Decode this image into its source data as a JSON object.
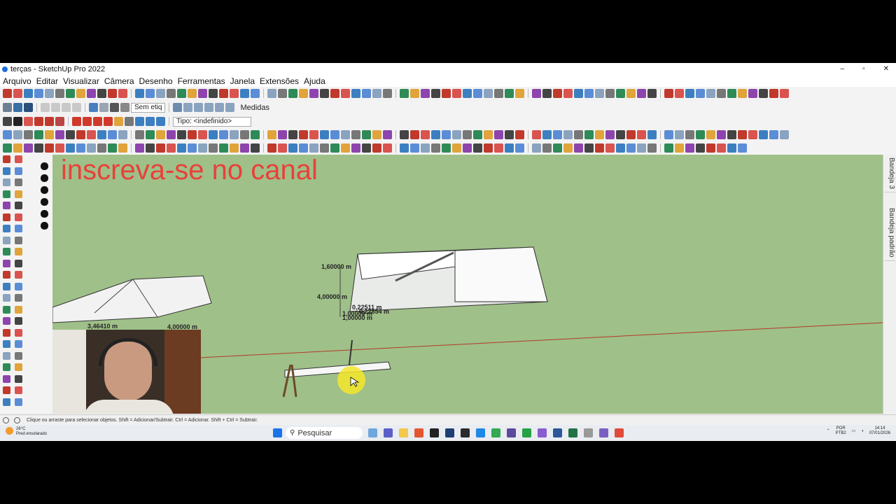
{
  "window": {
    "title": "terças - SketchUp Pro 2022",
    "controls": [
      "–",
      "▫",
      "✕"
    ]
  },
  "menu": [
    "Arquivo",
    "Editar",
    "Visualizar",
    "Câmera",
    "Desenho",
    "Ferramentas",
    "Janela",
    "Extensões",
    "Ajuda"
  ],
  "toolbar": {
    "tag_select": "Sem etiq",
    "measurements_label": "Medidas",
    "type_select": "Tipo: <indefinido>"
  },
  "viewport": {
    "overlay_text": "inscreva-se no canal",
    "dimensions": {
      "height_top": "1,60000 m",
      "depth": "4,00000 m",
      "small_a": "0,22511 m",
      "small_b": "0,22854 m",
      "small_c": "1,00000 m",
      "small_d": "1,00000 m",
      "left_a": "3,46410 m",
      "left_b": "4,00000 m"
    }
  },
  "trays": [
    "Bandeja 3",
    "Bandeja padrão"
  ],
  "status_bar": {
    "hint": "Clique ou arraste para selecionar objetos. Shift = Adicionar/Subtrair. Ctrl = Adicionar. Shift + Ctrl = Subtrair."
  },
  "taskbar": {
    "weather_temp": "26°C",
    "weather_desc": "Pred ensolarado",
    "search_placeholder": "Pesquisar",
    "lang": "POR",
    "lang2": "PTB2",
    "time": "14:14",
    "date": "07/01/2026"
  },
  "colors": {
    "viewport_bg": "#9fc089",
    "overlay_text": "#e8413a",
    "axis_red": "#c0392b"
  }
}
